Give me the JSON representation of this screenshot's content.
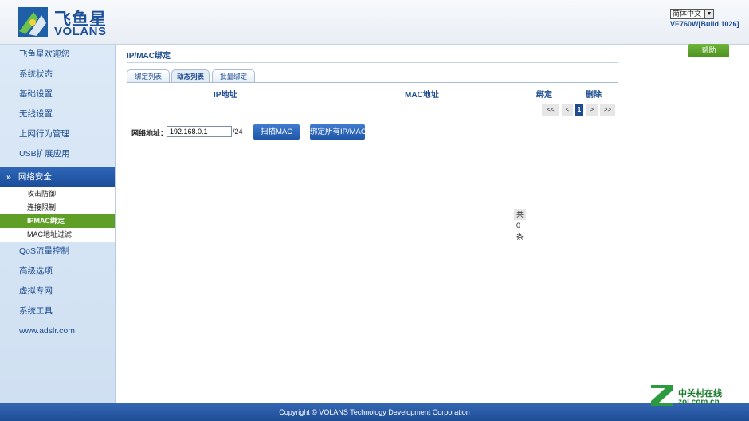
{
  "header": {
    "brand_cn": "飞鱼星",
    "brand_en": "VOLANS",
    "language": "简体中文",
    "firmware": "VE760W[Build 1026]"
  },
  "sidebar": {
    "items_top": [
      {
        "label": "飞鱼星欢迎您"
      },
      {
        "label": "系统状态"
      },
      {
        "label": "基础设置"
      },
      {
        "label": "无线设置"
      },
      {
        "label": "上网行为管理"
      },
      {
        "label": "USB扩展应用"
      }
    ],
    "active": {
      "label": "网络安全",
      "icon": "double-chevron-down-icon"
    },
    "sub_items": [
      {
        "label": "攻击防御"
      },
      {
        "label": "连接限制"
      },
      {
        "label": "IPMAC绑定"
      },
      {
        "label": "MAC地址过滤"
      }
    ],
    "items_bottom": [
      {
        "label": "QoS流量控制"
      },
      {
        "label": "高级选项"
      },
      {
        "label": "虚拟专网"
      },
      {
        "label": "系统工具"
      },
      {
        "label": "www.adslr.com"
      }
    ]
  },
  "main": {
    "title": "IP/MAC绑定",
    "help_label": "帮助",
    "tabs": [
      {
        "label": "绑定列表"
      },
      {
        "label": "动态列表"
      },
      {
        "label": "批量绑定"
      }
    ],
    "table_headers": [
      "IP地址",
      "MAC地址",
      "绑定",
      "删除"
    ],
    "pager": {
      "count": "共 0 条",
      "first": "<<",
      "prev": "<",
      "current": "1",
      "next": ">",
      "last": ">>"
    },
    "network_label": "网络地址：",
    "network_value": "192.168.0.1",
    "network_suffix": "/24",
    "scan_button": "扫描MAC",
    "bind_all_button": "绑定所有IP/MAC"
  },
  "footer": {
    "copyright": "Copyright © VOLANS Technology Development Corporation"
  },
  "watermark": {
    "cn": "中关村在线",
    "en": "zol.com.cn"
  },
  "colors": {
    "brand_blue": "#1e4f99",
    "nav_active": "#1a4c99",
    "sub_current": "#5f9e27",
    "help_green": "#4d9120",
    "watermark_green": "#1a7a2b"
  }
}
